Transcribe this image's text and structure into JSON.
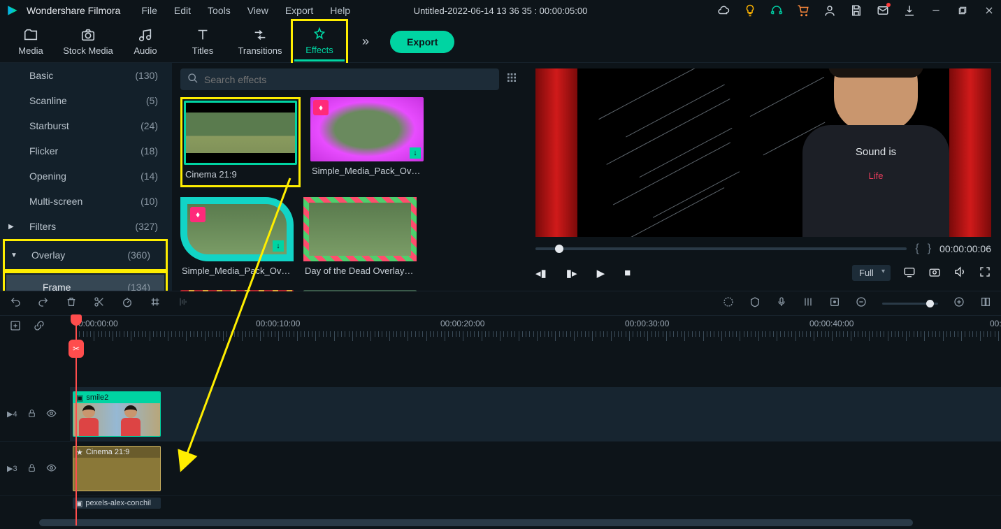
{
  "app_name": "Wondershare Filmora",
  "doc_title": "Untitled-2022-06-14 13 36 35 : 00:00:05:00",
  "menu": [
    "File",
    "Edit",
    "Tools",
    "View",
    "Export",
    "Help"
  ],
  "tabs": {
    "media": "Media",
    "stock": "Stock Media",
    "audio": "Audio",
    "titles": "Titles",
    "transitions": "Transitions",
    "effects": "Effects"
  },
  "export_label": "Export",
  "search": {
    "placeholder": "Search effects"
  },
  "sidebar": [
    {
      "label": "Basic",
      "count": "(130)",
      "indent": true
    },
    {
      "label": "Scanline",
      "count": "(5)",
      "indent": true
    },
    {
      "label": "Starburst",
      "count": "(24)",
      "indent": true
    },
    {
      "label": "Flicker",
      "count": "(18)",
      "indent": true
    },
    {
      "label": "Opening",
      "count": "(14)",
      "indent": true
    },
    {
      "label": "Multi-screen",
      "count": "(10)",
      "indent": true
    },
    {
      "label": "Filters",
      "count": "(327)",
      "indent": false,
      "chev": "▶"
    },
    {
      "label": "Overlay",
      "count": "(360)",
      "indent": false,
      "chev": "▼",
      "hl": true
    },
    {
      "label": "Frame",
      "count": "(134)",
      "indent": true,
      "sel": true,
      "hl": true
    }
  ],
  "fx": [
    {
      "label": "Cinema 21:9",
      "sel": true,
      "hl": true,
      "thumb": "letterbox"
    },
    {
      "label": "Simple_Media_Pack_Ove…",
      "badge": true,
      "dl": true,
      "thumb": "pink"
    },
    {
      "label": "Simple_Media_Pack_Ove…",
      "badge": true,
      "dl": true,
      "thumb": "tealframe"
    },
    {
      "label": "Day of the Dead Overlay …",
      "thumb": "flowers"
    }
  ],
  "preview": {
    "time": "00:00:00:06",
    "quality": "Full",
    "shirt_top": "Sound is",
    "shirt_bot": "Life"
  },
  "ruler": {
    "t0": "0:00:00:00",
    "t1": "00:00:10:00",
    "t2": "00:00:20:00",
    "t3": "00:00:30:00",
    "t4": "00:00:40:00",
    "t5": "00:"
  },
  "tracks": {
    "r1": "4",
    "r2": "3",
    "clip_vid": "smile2",
    "clip_fx": "Cinema 21:9",
    "clip_bottom": "pexels-alex-conchil"
  }
}
